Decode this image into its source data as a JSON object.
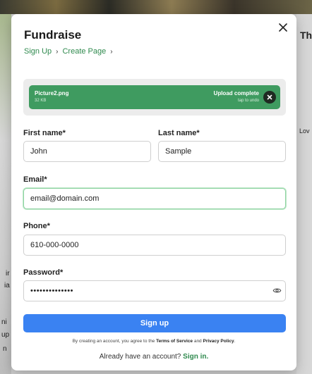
{
  "background": {
    "heading_fragment": "Th",
    "text_fragment_love": "Lov",
    "left_fragments": [
      "ir",
      "ia",
      "ni",
      "up",
      "n"
    ]
  },
  "modal": {
    "title": "Fundraise",
    "breadcrumb": [
      {
        "label": "Sign Up"
      },
      {
        "label": "Create Page"
      }
    ],
    "breadcrumb_separator": "›",
    "upload": {
      "file_name": "Picture2.png",
      "file_size": "32 KB",
      "status": "Upload complete",
      "sub_status": "tap to undo"
    },
    "form": {
      "first_name": {
        "label": "First name*",
        "value": "John"
      },
      "last_name": {
        "label": "Last name*",
        "value": "Sample"
      },
      "email": {
        "label": "Email*",
        "value": "email@domain.com"
      },
      "phone": {
        "label": "Phone*",
        "value": "610-000-0000"
      },
      "password": {
        "label": "Password*",
        "value": "••••••••••••••"
      }
    },
    "submit_label": "Sign up",
    "terms": {
      "prefix": "By creating an account, you agree to the",
      "tos": "Terms of Service",
      "and": "and",
      "privacy": "Privacy Policy",
      "suffix": "."
    },
    "signin": {
      "prompt": "Already have an account?",
      "link": "Sign in."
    }
  },
  "colors": {
    "accent_green": "#3f9b60",
    "primary_blue": "#3a82f2",
    "link_green": "#2f8a4e"
  }
}
